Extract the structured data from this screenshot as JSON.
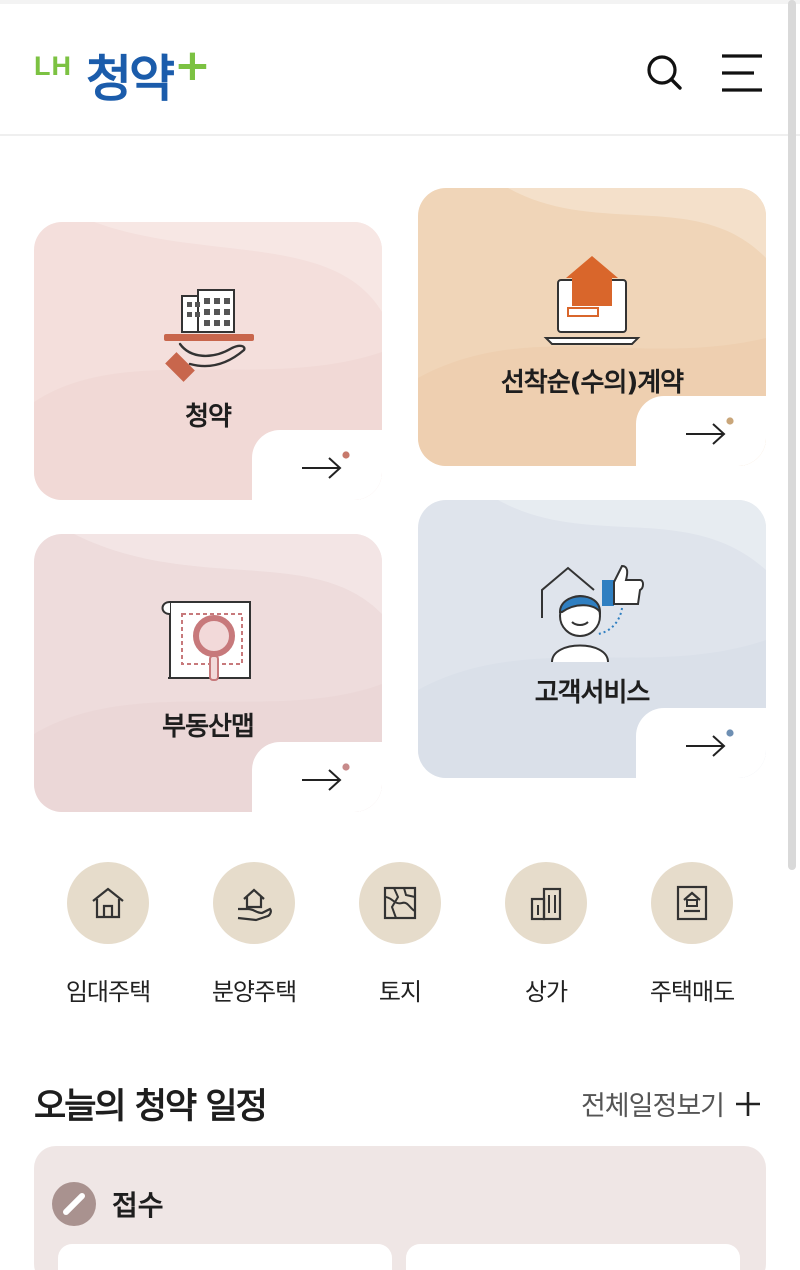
{
  "header": {
    "logo_lh": "LH",
    "logo_main": "청약",
    "logo_plus": "+"
  },
  "cards": [
    {
      "title": "청약",
      "icon": "building-hand-icon",
      "dot_color": "#c7796b"
    },
    {
      "title": "선착순(수의)계약",
      "icon": "laptop-house-icon",
      "dot_color": "#c9a67a"
    },
    {
      "title": "부동산맵",
      "icon": "map-magnifier-icon",
      "dot_color": "#c78a8a"
    },
    {
      "title": "고객서비스",
      "icon": "customer-thumbs-up-icon",
      "dot_color": "#6e8fb3"
    }
  ],
  "categories": [
    {
      "label": "임대주택",
      "icon": "house-icon"
    },
    {
      "label": "분양주택",
      "icon": "house-hand-icon"
    },
    {
      "label": "토지",
      "icon": "land-map-icon"
    },
    {
      "label": "상가",
      "icon": "building-icon"
    },
    {
      "label": "주택매도",
      "icon": "house-document-icon"
    }
  ],
  "schedule": {
    "title": "오늘의 청약 일정",
    "view_all": "전체일정보기",
    "status_label": "접수"
  },
  "colors": {
    "brand_blue": "#1b5cab",
    "brand_green": "#7cc242",
    "accent_orange": "#d9662b",
    "category_circle": "#e6dccb"
  }
}
